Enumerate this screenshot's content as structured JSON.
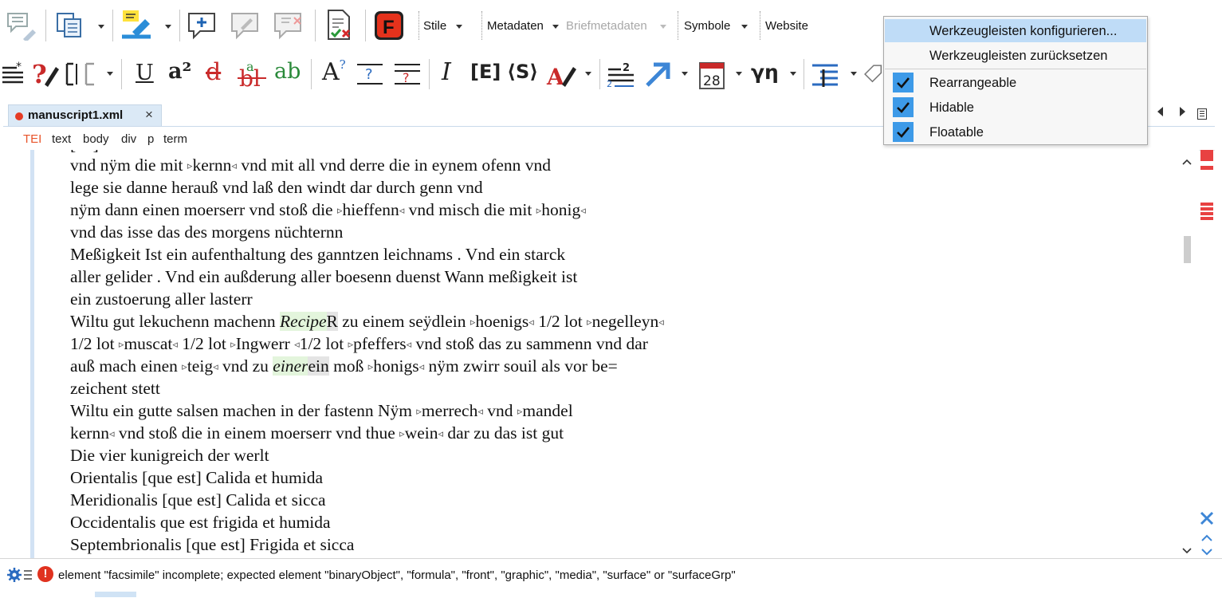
{
  "toolbar": {
    "menus": [
      {
        "label": "Stile",
        "enabled": true
      },
      {
        "label": "Metadaten",
        "enabled": true
      },
      {
        "label": "Briefmetadaten",
        "enabled": false
      },
      {
        "label": "Symbole",
        "enabled": true
      },
      {
        "label": "Website",
        "enabled": true
      }
    ],
    "format_buttons": {
      "superscript": "a²",
      "unclear_label": "ab",
      "expan": "[E]",
      "seg": "⟨S⟩",
      "italic": "I",
      "number": "28",
      "greek": "γη"
    }
  },
  "tab": {
    "title": "manuscript1.xml",
    "modified": true,
    "close": "×"
  },
  "breadcrumb": [
    "TEI",
    "text",
    "body",
    "div",
    "p",
    "term"
  ],
  "editor": {
    "partial_top_line": "[…] ",
    "lines": [
      {
        "parts": [
          {
            "t": "vnd nÿm die mit "
          },
          {
            "tag": "▹"
          },
          {
            "t": "kernn"
          },
          {
            "tag": "◃"
          },
          {
            "t": " vnd mit all vnd derre die in eynem ofenn vnd"
          }
        ]
      },
      {
        "parts": [
          {
            "t": "lege sie danne herauß vnd laß den windt dar durch genn vnd"
          }
        ]
      },
      {
        "parts": [
          {
            "t": "nÿm dann einen moerserr vnd stoß die "
          },
          {
            "tag": "▹"
          },
          {
            "t": "hieffenn"
          },
          {
            "tag": "◃"
          },
          {
            "t": " vnd misch die mit "
          },
          {
            "tag": "▹"
          },
          {
            "t": "honig"
          },
          {
            "tag": "◃"
          }
        ]
      },
      {
        "parts": [
          {
            "t": "vnd das isse das des morgens nüchternn"
          }
        ]
      },
      {
        "parts": [
          {
            "t": "Meßigkeit Ist ein aufenthaltung des ganntzen leichnams . Vnd ein starck"
          }
        ]
      },
      {
        "parts": [
          {
            "t": "aller gelider . Vnd ein außderung aller boesenn duenst Wann meßigkeit ist"
          }
        ]
      },
      {
        "parts": [
          {
            "t": "ein zustoerung aller lasterr"
          }
        ]
      },
      {
        "parts": [
          {
            "t": "Wiltu gut lekuchenn machenn "
          },
          {
            "recipe": "Recipe"
          },
          {
            "sel": "R"
          },
          {
            "t": " zu einem seÿdlein "
          },
          {
            "tag": "▹"
          },
          {
            "t": "hoenigs"
          },
          {
            "tag": "◃"
          },
          {
            "t": " 1/2 lot "
          },
          {
            "tag": "▹"
          },
          {
            "t": "negelleyn"
          },
          {
            "tag": "◃"
          }
        ]
      },
      {
        "parts": [
          {
            "t": "1/2 lot "
          },
          {
            "tag": "▹"
          },
          {
            "t": "muscat"
          },
          {
            "tag": "◃"
          },
          {
            "t": " 1/2 lot "
          },
          {
            "tag": "▹"
          },
          {
            "t": "Ingwerr "
          },
          {
            "tag": "◃"
          },
          {
            "t": "1/2 lot "
          },
          {
            "tag": "▹"
          },
          {
            "t": "pfeffers"
          },
          {
            "tag": "◃"
          },
          {
            "t": " vnd stoß das zu sammenn vnd dar"
          }
        ]
      },
      {
        "parts": [
          {
            "t": "auß mach einen "
          },
          {
            "tag": "▹"
          },
          {
            "t": "teig"
          },
          {
            "tag": "◃"
          },
          {
            "t": " vnd zu "
          },
          {
            "recipe": "einer"
          },
          {
            "sel": "ein"
          },
          {
            "t": " moß "
          },
          {
            "tag": "▹"
          },
          {
            "t": "honigs"
          },
          {
            "tag": "◃"
          },
          {
            "t": " nÿm zwirr souil als vor be="
          }
        ]
      },
      {
        "parts": [
          {
            "t": "zeichent stett"
          }
        ]
      },
      {
        "parts": [
          {
            "t": "Wiltu ein gutte salsen machen in der fastenn Nÿm "
          },
          {
            "tag": "▹"
          },
          {
            "t": "merrech"
          },
          {
            "tag": "◃"
          },
          {
            "t": " vnd "
          },
          {
            "tag": "▹"
          },
          {
            "t": "mandel"
          }
        ]
      },
      {
        "parts": [
          {
            "t": "kernn"
          },
          {
            "tag": "◃"
          },
          {
            "t": " vnd stoß die in einem moerserr vnd thue "
          },
          {
            "tag": "▹"
          },
          {
            "t": "wein"
          },
          {
            "tag": "◃"
          },
          {
            "t": " dar zu das ist gut"
          }
        ]
      },
      {
        "parts": [
          {
            "t": "Die vier kunigreich der werlt"
          }
        ]
      },
      {
        "parts": [
          {
            "t": "Orientalis [que est] Calida et humida"
          }
        ]
      },
      {
        "parts": [
          {
            "t": "Meridionalis [que est] Calida et sicca"
          }
        ]
      },
      {
        "parts": [
          {
            "t": "Occidentalis que est frigida et humida"
          }
        ]
      },
      {
        "parts": [
          {
            "t": "Septembrionalis [que est] Frigida et sicca"
          }
        ]
      }
    ]
  },
  "status": {
    "message": "element \"facsimile\" incomplete; expected element \"binaryObject\", \"formula\", \"front\", \"graphic\", \"media\", \"surface\" or \"surfaceGrp\"",
    "error_symbol": "!"
  },
  "popup_menu": {
    "items": [
      {
        "label": "Werkzeugleisten konfigurieren...",
        "highlighted": true
      },
      {
        "label": "Werkzeugleisten zurücksetzen",
        "highlighted": false
      }
    ],
    "checkbox_items": [
      {
        "label": "Rearrangeable",
        "checked": true
      },
      {
        "label": "Hidable",
        "checked": true
      },
      {
        "label": "Floatable",
        "checked": true
      }
    ]
  },
  "colors": {
    "accent": "#3d9ae8",
    "menu_highlight": "#bfdcf7",
    "error": "#e0321f",
    "recipe_highlight": "#e3f5dc",
    "breadcrumb_root": "#e8542a"
  }
}
